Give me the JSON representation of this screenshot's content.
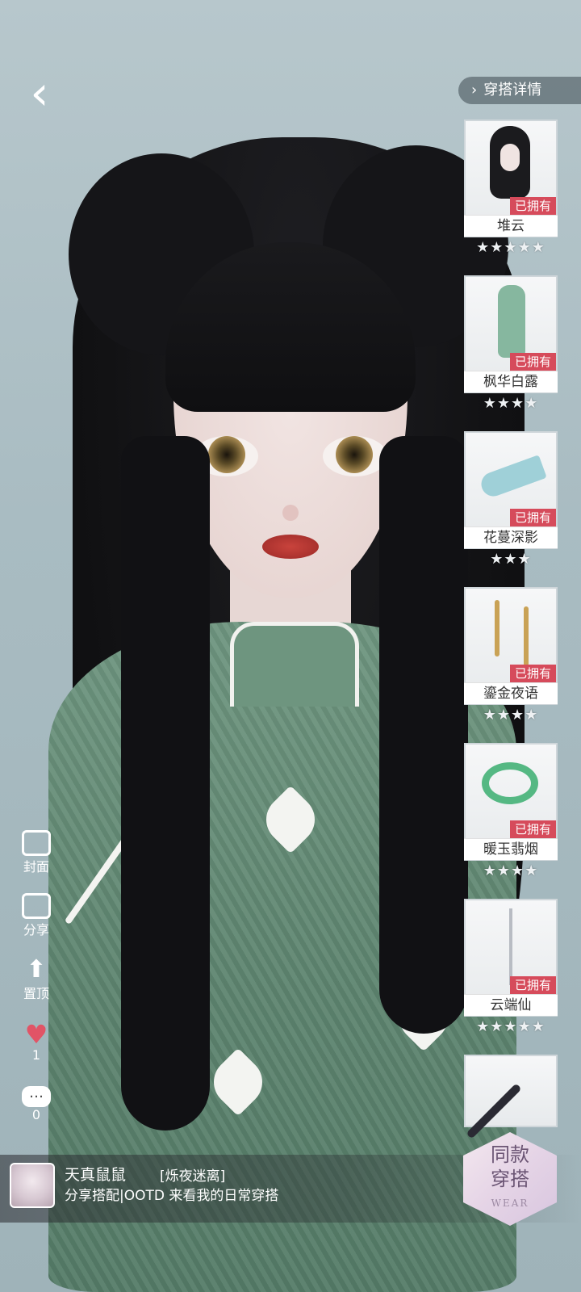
{
  "nav": {
    "back_icon": "chevron-left-icon"
  },
  "detail_tab": {
    "label": "穿搭详情",
    "icon": "chevron-right-icon"
  },
  "items": [
    {
      "name": "堆云",
      "status": "已拥有",
      "stars": "★★★★★"
    },
    {
      "name": "枫华白露",
      "status": "已拥有",
      "stars": "★★★★"
    },
    {
      "name": "花蔓深影",
      "status": "已拥有",
      "stars": "★★★"
    },
    {
      "name": "鎏金夜语",
      "status": "已拥有",
      "stars": "★★★★"
    },
    {
      "name": "暖玉翡烟",
      "status": "已拥有",
      "stars": "★★★★"
    },
    {
      "name": "云端仙",
      "status": "已拥有",
      "stars": "★★★★★"
    },
    {
      "name": "",
      "status": "",
      "stars": ""
    }
  ],
  "left_bar": {
    "cover_label": "封面",
    "share_label": "分享",
    "pin_label": "置顶",
    "likes": "1",
    "comments": "0"
  },
  "footer": {
    "username": "天真鼠鼠",
    "outfit_tag": "[烁夜迷离]",
    "description": "分享搭配|OOTD 来看我的日常穿搭"
  },
  "same_outfit": {
    "line1": "同款",
    "line2": "穿搭",
    "badge": "WEAR"
  },
  "colors": {
    "owned_badge": "#d64b5b",
    "heart": "#e15466",
    "tab_bg": "#3c4850"
  }
}
